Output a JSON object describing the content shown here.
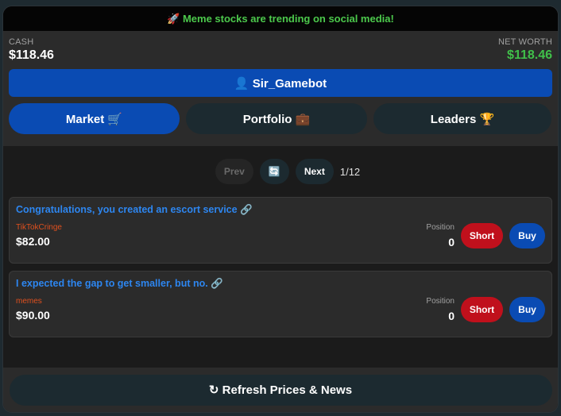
{
  "banner": {
    "text": "🚀 Meme stocks are trending on social media!"
  },
  "stats": {
    "cash_label": "CASH",
    "cash_value": "$118.46",
    "networth_label": "NET WORTH",
    "networth_value": "$118.46"
  },
  "user": {
    "name": "👤 Sir_Gamebot"
  },
  "tabs": [
    {
      "label": "Market 🛒",
      "active": true
    },
    {
      "label": "Portfolio 💼",
      "active": false
    },
    {
      "label": "Leaders 🏆",
      "active": false
    }
  ],
  "pager": {
    "prev_label": "Prev",
    "refresh_icon": "🔄",
    "next_label": "Next",
    "indicator": "1/12"
  },
  "stocks": [
    {
      "title": "Congratulations, you created an escort service 🔗",
      "subreddit": "TikTokCringe",
      "price": "$82.00",
      "position_label": "Position",
      "position_value": "0",
      "short_label": "Short",
      "buy_label": "Buy"
    },
    {
      "title": "I expected the gap to get smaller, but no. 🔗",
      "subreddit": "memes",
      "price": "$90.00",
      "position_label": "Position",
      "position_value": "0",
      "short_label": "Short",
      "buy_label": "Buy"
    }
  ],
  "footer": {
    "refresh_label": "↻ Refresh Prices & News"
  },
  "colors": {
    "accent_blue": "#0a4bb3",
    "short_red": "#c0101c",
    "positive_green": "#40c04a",
    "link_blue": "#2d86f0",
    "subreddit_orange": "#e0501e"
  }
}
